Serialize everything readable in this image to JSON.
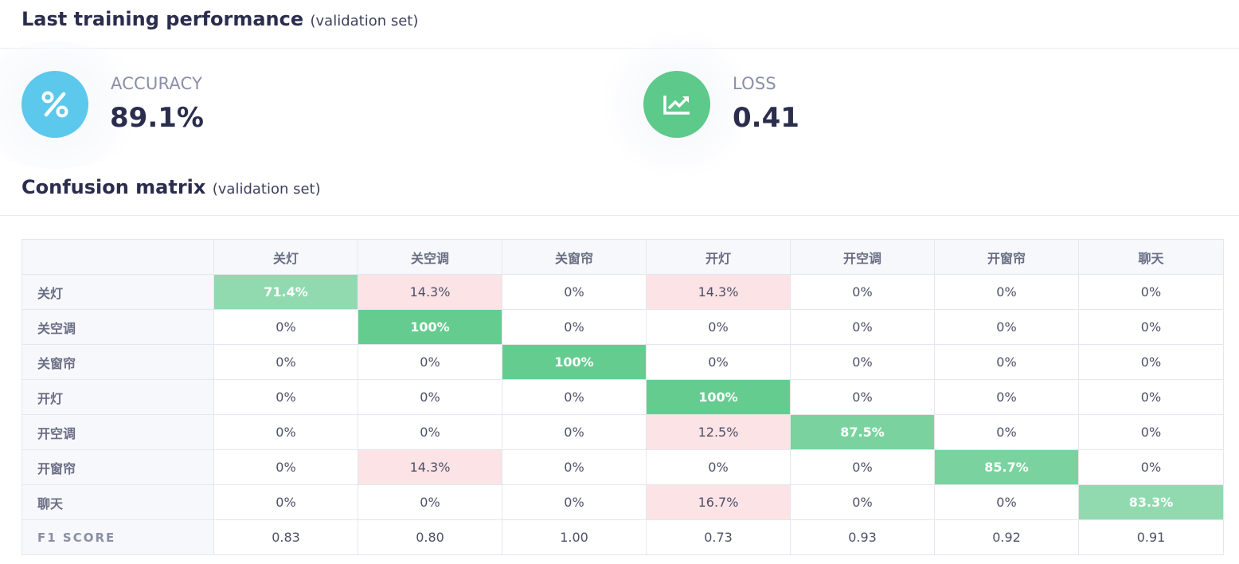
{
  "performance": {
    "title": "Last training performance",
    "subtitle": "(validation set)",
    "accuracy": {
      "label": "ACCURACY",
      "value": "89.1%",
      "icon": "percent-icon",
      "color": "#5bc8ec"
    },
    "loss": {
      "label": "LOSS",
      "value": "0.41",
      "icon": "trend-chart-icon",
      "color": "#5dc98a"
    }
  },
  "confusion": {
    "title": "Confusion matrix",
    "subtitle": "(validation set)",
    "columns": [
      "关灯",
      "关空调",
      "关窗帘",
      "开灯",
      "开空调",
      "开窗帘",
      "聊天"
    ],
    "rows": [
      {
        "label": "关灯",
        "cells": [
          "71.4%",
          "14.3%",
          "0%",
          "14.3%",
          "0%",
          "0%",
          "0%"
        ]
      },
      {
        "label": "关空调",
        "cells": [
          "0%",
          "100%",
          "0%",
          "0%",
          "0%",
          "0%",
          "0%"
        ]
      },
      {
        "label": "关窗帘",
        "cells": [
          "0%",
          "0%",
          "100%",
          "0%",
          "0%",
          "0%",
          "0%"
        ]
      },
      {
        "label": "开灯",
        "cells": [
          "0%",
          "0%",
          "0%",
          "100%",
          "0%",
          "0%",
          "0%"
        ]
      },
      {
        "label": "开空调",
        "cells": [
          "0%",
          "0%",
          "0%",
          "12.5%",
          "87.5%",
          "0%",
          "0%"
        ]
      },
      {
        "label": "开窗帘",
        "cells": [
          "0%",
          "14.3%",
          "0%",
          "0%",
          "0%",
          "85.7%",
          "0%"
        ]
      },
      {
        "label": "聊天",
        "cells": [
          "0%",
          "0%",
          "0%",
          "16.7%",
          "0%",
          "0%",
          "83.3%"
        ]
      }
    ],
    "f1": {
      "label": "F1 SCORE",
      "values": [
        "0.83",
        "0.80",
        "1.00",
        "0.73",
        "0.93",
        "0.92",
        "0.91"
      ]
    },
    "colors": {
      "correct": "#5dc98a",
      "miss": "#fbe3e6"
    }
  }
}
